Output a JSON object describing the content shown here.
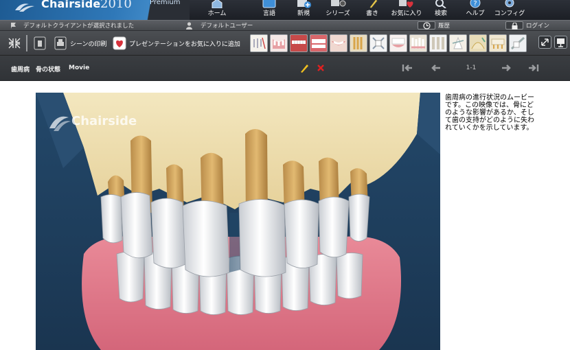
{
  "brand": {
    "name": "Chairside",
    "year": "2010",
    "edition": "Premium",
    "watermark": "Chairside"
  },
  "nav": {
    "items": [
      {
        "label": "ホーム",
        "icon": "home-icon"
      },
      {
        "label": "言語",
        "icon": "language-icon"
      },
      {
        "label": "新規",
        "icon": "new-icon"
      },
      {
        "label": "シリーズ",
        "icon": "series-icon"
      },
      {
        "label": "書き",
        "icon": "pen-icon"
      },
      {
        "label": "お気に入り",
        "icon": "heart-icon"
      },
      {
        "label": "検索",
        "icon": "search-icon"
      },
      {
        "label": "ヘルプ",
        "icon": "help-icon"
      },
      {
        "label": "コンフィグ",
        "icon": "config-icon"
      }
    ]
  },
  "status": {
    "client": "デフォルトクライアントが選択されました",
    "user": "デフォルトユーザー",
    "history": "履歴",
    "login": "ログイン"
  },
  "toolbar": {
    "print": "シーンの印刷",
    "favorite": "プレゼンテーションをお気に入りに追加"
  },
  "breadcrumb": {
    "part1": "歯周病",
    "part2": "骨の状態",
    "part3": "Movie"
  },
  "pager": {
    "counter": "1-1"
  },
  "description": "歯周病の進行状況のムービーです。この映像では、骨にどのような影響があるか、そして歯の支持がどのように失われていくかを示しています。",
  "colors": {
    "accent": "#2f78b8",
    "favorite": "#d8323c",
    "edit": "#f0c020",
    "delete": "#e02020",
    "viewer_bg": "#1f3f5a"
  }
}
